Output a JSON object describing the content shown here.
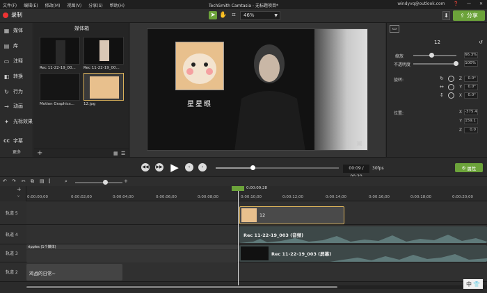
{
  "menubar": {
    "menus": [
      "文件(F)",
      "编辑(E)",
      "修改(M)",
      "视图(V)",
      "分享(S)",
      "帮助(H)"
    ],
    "title": "TechSmith Camtasia - 无标题项目*",
    "user": "windyvq@outlook.com",
    "help_icon": "help-icon",
    "minimize": "—",
    "close": "✕"
  },
  "toolbar": {
    "record_label": "录制",
    "zoom_value": "46%",
    "share_label": "分享"
  },
  "sidebar": {
    "items": [
      {
        "label": "媒体",
        "icon": "media-icon",
        "glyph": "▦"
      },
      {
        "label": "库",
        "icon": "library-icon",
        "glyph": "▤"
      },
      {
        "label": "注释",
        "icon": "annotation-icon",
        "glyph": "▭"
      },
      {
        "label": "转换",
        "icon": "transition-icon",
        "glyph": "◧"
      },
      {
        "label": "行为",
        "icon": "behavior-icon",
        "glyph": "↻"
      },
      {
        "label": "动画",
        "icon": "animation-icon",
        "glyph": "→"
      },
      {
        "label": "光标效果",
        "icon": "cursor-effect-icon",
        "glyph": "✦"
      },
      {
        "label": "字幕",
        "icon": "caption-icon",
        "glyph": "CC"
      }
    ],
    "more_label": "更多"
  },
  "media_bin": {
    "title": "媒体箱",
    "items": [
      {
        "label": "Rec 11-22-19_00..."
      },
      {
        "label": "Rec 11-22-19_00..."
      },
      {
        "label": "Motion Graphics..."
      },
      {
        "label": "12.jpg"
      }
    ]
  },
  "canvas": {
    "caption": "星星眼"
  },
  "properties": {
    "name": "12",
    "scale_label": "缩放",
    "scale_value": "66.3%",
    "scale_level": 0.42,
    "opacity_label": "不透明度",
    "opacity_value": "100%",
    "opacity_level": 1.0,
    "rotation_label": "旋转:",
    "rotation": [
      {
        "axis": "Z",
        "value": "0.0°"
      },
      {
        "axis": "Y",
        "value": "0.0°"
      },
      {
        "axis": "X",
        "value": "0.0°"
      }
    ],
    "position_label": "位置:",
    "position": [
      {
        "axis": "X",
        "value": "-375.4"
      },
      {
        "axis": "Y",
        "value": "159.1"
      },
      {
        "axis": "Z",
        "value": "0.0"
      }
    ],
    "attr_button": "属性"
  },
  "playback": {
    "timecode": "00:09 / 00:30",
    "fps": "30fps",
    "progress": 0.3
  },
  "timeline": {
    "playhead_time": "0:00:09;28",
    "ruler_labels": [
      "0:00:00;00",
      "0:00:02;00",
      "0:00:04;00",
      "0:00:06;00",
      "0:00:08;00",
      "0:00:10;00",
      "0:00:12;00",
      "0:00:14;00",
      "0:00:16;00",
      "0:00:18;00",
      "0:00:20;00"
    ],
    "tracks": [
      {
        "label": "轨道 5"
      },
      {
        "label": "轨道 4"
      },
      {
        "label": "轨道 3"
      },
      {
        "label": "轨道 2"
      }
    ],
    "clips": {
      "image_clip": "12",
      "audio_clip": "Rec 11-22-19_003 (音频)",
      "screen_clip": "Rec 11-22-19_003 (屏幕)",
      "ripples_label": "ripples  (1个媒体)",
      "text_clip": "鸡战的日常~"
    }
  },
  "ime": {
    "label": "中"
  }
}
